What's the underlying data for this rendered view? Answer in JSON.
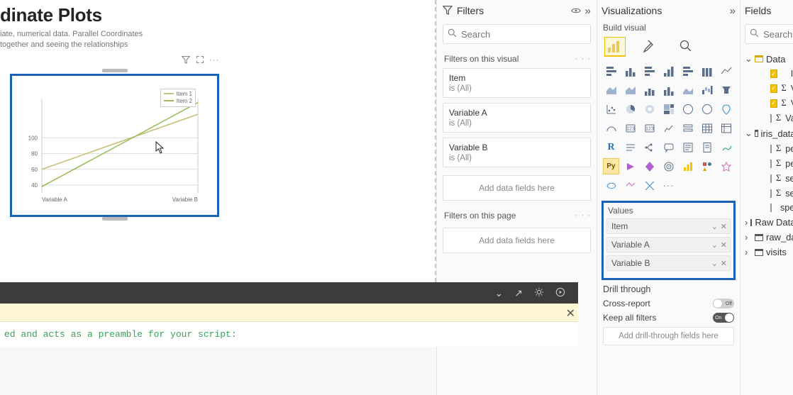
{
  "canvas": {
    "title": "dinate Plots",
    "subtitle_line1": "iate, numerical data. Parallel Coordinates",
    "subtitle_line2": "together and seeing the relationships"
  },
  "chart_data": {
    "type": "line",
    "categories": [
      "Variable A",
      "Variable B"
    ],
    "series": [
      {
        "name": "Item 1",
        "values": [
          60,
          130
        ],
        "color": "#c9c07a"
      },
      {
        "name": "Item 2",
        "values": [
          38,
          145
        ],
        "color": "#9abf5a"
      }
    ],
    "xlabel_left": "Variable A",
    "xlabel_right": "Variable B",
    "yticks": [
      40,
      60,
      80,
      100
    ],
    "ylim": [
      30,
      150
    ],
    "legend_position": "top-right",
    "grid": true
  },
  "filters": {
    "pane_title": "Filters",
    "search_placeholder": "Search",
    "group_visual": "Filters on this visual",
    "group_page": "Filters on this page",
    "cards": [
      {
        "name": "Item",
        "state": "is (All)"
      },
      {
        "name": "Variable A",
        "state": "is (All)"
      },
      {
        "name": "Variable B",
        "state": "is (All)"
      }
    ],
    "add_visual": "Add data fields here",
    "add_page": "Add data fields here"
  },
  "viz": {
    "pane_title": "Visualizations",
    "build_label": "Build visual",
    "values_title": "Values",
    "values": [
      "Item",
      "Variable A",
      "Variable B"
    ],
    "drill_title": "Drill through",
    "cross_report": "Cross-report",
    "cross_report_state": "Off",
    "keep_all": "Keep all filters",
    "keep_all_state": "On",
    "drill_add": "Add drill-through fields here"
  },
  "fields": {
    "pane_title": "Fields",
    "search_placeholder": "Search",
    "tables": {
      "data_name": "Data",
      "data_cols": [
        {
          "label": "Item",
          "checked": true,
          "sigma": false
        },
        {
          "label": "Variabl",
          "checked": true,
          "sigma": true
        },
        {
          "label": "Variabl",
          "checked": true,
          "sigma": true
        },
        {
          "label": "Variabl",
          "checked": false,
          "sigma": true
        }
      ],
      "iris_name": "iris_dataset",
      "iris_cols": [
        {
          "label": "petal_l",
          "sigma": true
        },
        {
          "label": "petal_w",
          "sigma": true
        },
        {
          "label": "sepal_l",
          "sigma": true
        },
        {
          "label": "sepal_w",
          "sigma": true
        },
        {
          "label": "species",
          "sigma": false
        }
      ],
      "others": [
        "Raw Data - M",
        "raw_data",
        "visits"
      ]
    }
  },
  "editor": {
    "line": "ed and acts as a preamble for your script:"
  }
}
